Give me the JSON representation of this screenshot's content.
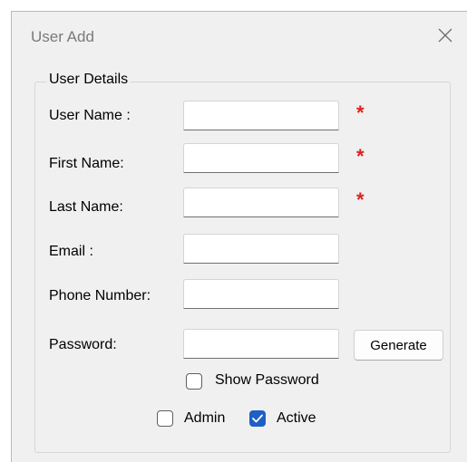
{
  "window": {
    "title": "User Add"
  },
  "group": {
    "title": "User Details"
  },
  "fields": {
    "username": {
      "label": "User Name :",
      "value": "",
      "required": true
    },
    "firstname": {
      "label": "First Name:",
      "value": "",
      "required": true
    },
    "lastname": {
      "label": "Last Name:",
      "value": "",
      "required": true
    },
    "email": {
      "label": "Email :",
      "value": ""
    },
    "phone": {
      "label": "Phone Number:",
      "value": ""
    },
    "password": {
      "label": "Password:",
      "value": ""
    }
  },
  "required_marker": "*",
  "buttons": {
    "generate": "Generate"
  },
  "checkboxes": {
    "show_password": {
      "label": "Show Password",
      "checked": false
    },
    "admin": {
      "label": "Admin",
      "checked": false
    },
    "active": {
      "label": "Active",
      "checked": true
    }
  },
  "colors": {
    "accent": "#1d5fc4",
    "required": "#e02020"
  },
  "icons": {
    "close": "close-icon",
    "checkmark": "checkmark-icon"
  }
}
